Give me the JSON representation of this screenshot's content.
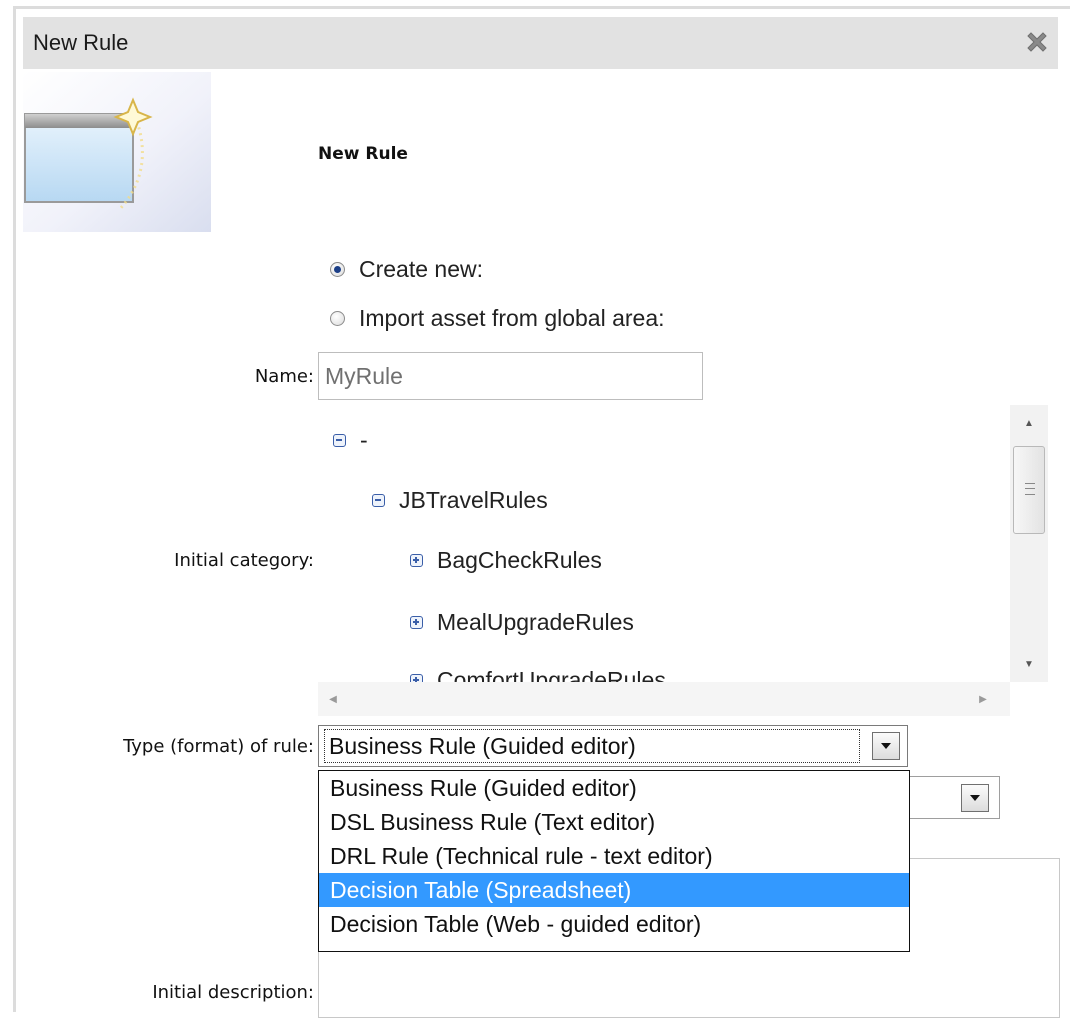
{
  "dialog": {
    "title": "New Rule",
    "close_icon": "close-x-icon"
  },
  "header": {
    "title": "New Rule",
    "image_icon": "new-window-wizard-icon"
  },
  "options": {
    "create_new": "Create new:",
    "import_asset": "Import asset from global area:",
    "selected": "create_new"
  },
  "form": {
    "name_label": "Name:",
    "name_value": "MyRule",
    "category_label": "Initial category:",
    "type_label": "Type (format) of rule:",
    "description_label": "Initial description:"
  },
  "category_tree": [
    {
      "label": "-",
      "state": "expanded"
    },
    {
      "label": "JBTravelRules",
      "state": "expanded"
    },
    {
      "label": "BagCheckRules",
      "state": "collapsed"
    },
    {
      "label": "MealUpgradeRules",
      "state": "collapsed"
    },
    {
      "label": "ComfortUpgradeRules",
      "state": "collapsed"
    }
  ],
  "rule_type": {
    "selected_value": "Business Rule (Guided editor)",
    "options": [
      "Business Rule (Guided editor)",
      "DSL Business Rule (Text editor)",
      "DRL Rule (Technical rule - text editor)",
      "Decision Table (Spreadsheet)",
      "Decision Table (Web - guided editor)"
    ],
    "highlighted_option": "Decision Table (Spreadsheet)"
  },
  "colors": {
    "title_bar": "#e2e2e2",
    "highlight": "#3399ff",
    "tree_icon": "#3a5ea8"
  }
}
